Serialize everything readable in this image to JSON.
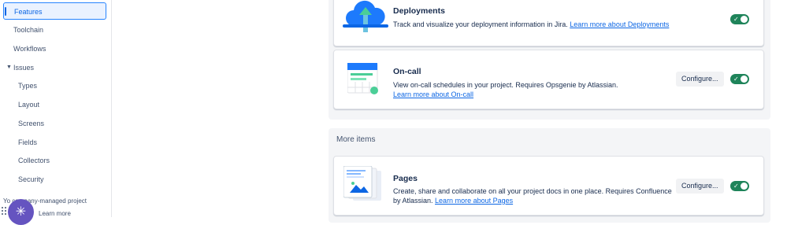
{
  "sidebar": {
    "items": [
      {
        "label": "Features"
      },
      {
        "label": "Toolchain"
      },
      {
        "label": "Workflows"
      },
      {
        "label": "Issues"
      },
      {
        "label": "Types"
      },
      {
        "label": "Layout"
      },
      {
        "label": "Screens"
      },
      {
        "label": "Fields"
      },
      {
        "label": "Collectors"
      },
      {
        "label": "Security"
      }
    ],
    "footer_text": "Yo company-managed project",
    "footer_link": "Learn more"
  },
  "cards": {
    "deployments": {
      "title": "Deployments",
      "desc": "Track and visualize your deployment information in Jira.",
      "link": "Learn more about Deployments",
      "enabled": true
    },
    "oncall": {
      "title": "On-call",
      "desc": "View on-call schedules in your project. Requires Opsgenie by Atlassian.",
      "link": "Learn more about On-call",
      "configure": "Configure...",
      "enabled": true
    },
    "pages": {
      "title": "Pages",
      "desc": "Create, share and collaborate on all your project docs in one place. Requires Confluence by Atlassian.",
      "link": "Learn more about Pages",
      "configure": "Configure...",
      "enabled": true
    }
  },
  "more_items": {
    "title": "More items"
  },
  "colors": {
    "accent": "#0c66e4",
    "toggle_on": "#1f845a",
    "fab": "#6554c0"
  }
}
